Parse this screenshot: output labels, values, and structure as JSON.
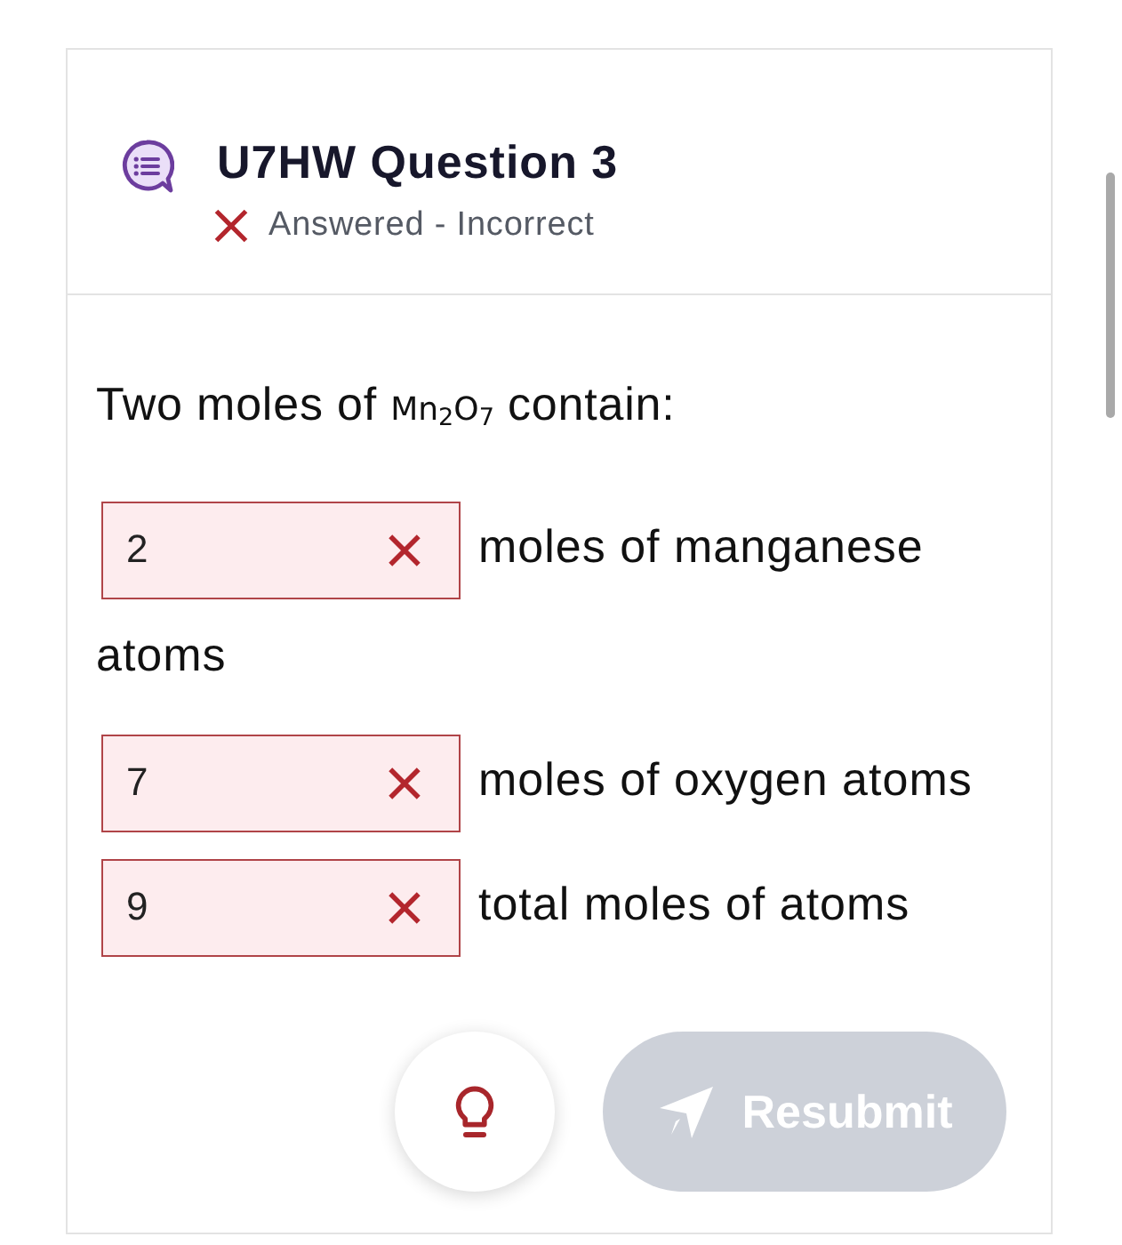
{
  "header": {
    "title": "U7HW Question 3",
    "status": {
      "kind": "incorrect",
      "text": "Answered - Incorrect"
    }
  },
  "question": {
    "prompt_start": "Two moles of",
    "formula": "Mn$_{2}$O$_{7}$",
    "prompt_end": "contain:"
  },
  "blanks": [
    {
      "value": "2",
      "correct": false,
      "text_after": "moles of manganese atoms"
    },
    {
      "value": "7",
      "correct": false,
      "text_after": "moles of oxygen atoms"
    },
    {
      "value": "9",
      "correct": false,
      "text_after": "total moles of atoms"
    }
  ],
  "resubmit": {
    "label": "Resubmit",
    "disabled": true
  }
}
